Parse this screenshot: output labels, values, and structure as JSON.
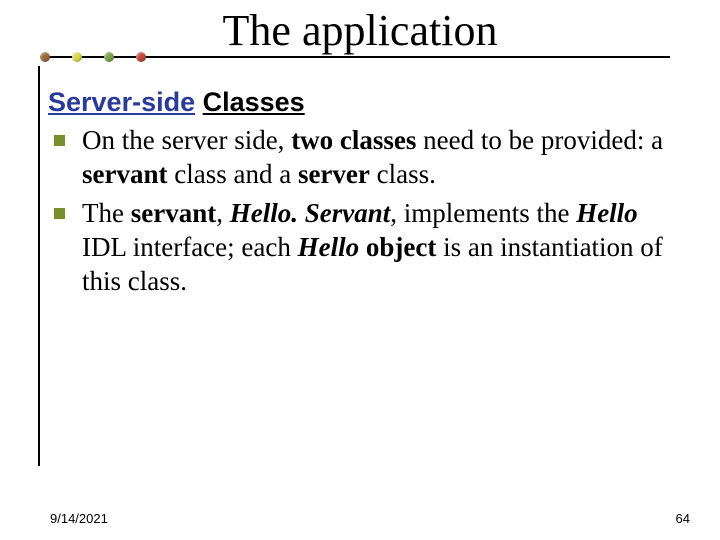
{
  "title": "The application",
  "subhead": {
    "server_side": "Server-side",
    "classes": "Classes"
  },
  "bullets": {
    "b1": {
      "t1": " On the server side, ",
      "two_classes": "two classes",
      "t2": " need to be provided: a ",
      "servant": "servant",
      "t3": " class and a ",
      "server": "server",
      "t4": " class."
    },
    "b2": {
      "t1": "The ",
      "servant": "servant",
      "t2": ", ",
      "hello_servant": "Hello. Servant",
      "t3": ", implements the ",
      "hello_idl": "Hello",
      "t4": " IDL interface; each ",
      "hello_object": "Hello",
      "object_word": " object",
      "t5": " is an instantiation of this class."
    }
  },
  "footer": {
    "date": "9/14/2021",
    "page": "64"
  }
}
